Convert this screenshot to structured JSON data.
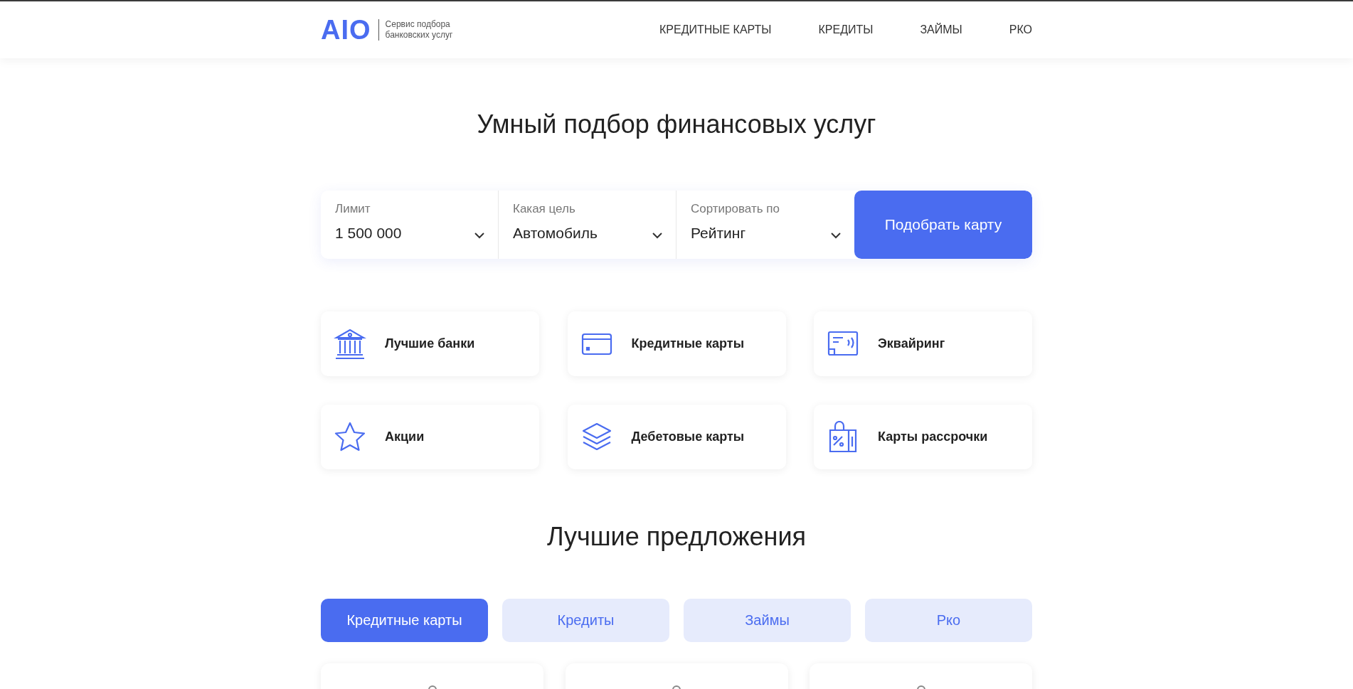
{
  "header": {
    "logo": "AIO",
    "tagline": "Сервис подбора банковских услуг",
    "nav": [
      "КРЕДИТНЫЕ КАРТЫ",
      "КРЕДИТЫ",
      "ЗАЙМЫ",
      "РКО"
    ]
  },
  "title": "Умный подбор финансовых услуг",
  "search": {
    "fields": [
      {
        "label": "Лимит",
        "value": "1 500 000"
      },
      {
        "label": "Какая цель",
        "value": "Автомобиль"
      },
      {
        "label": "Сортировать по",
        "value": "Рейтинг"
      }
    ],
    "button": "Подобрать карту"
  },
  "categories": [
    {
      "kind": "bank",
      "label": "Лучшие банки"
    },
    {
      "kind": "card",
      "label": "Кредитные карты"
    },
    {
      "kind": "terminal",
      "label": "Эквайринг"
    },
    {
      "kind": "star",
      "label": "Акции"
    },
    {
      "kind": "layers",
      "label": "Дебетовые карты"
    },
    {
      "kind": "bag",
      "label": "Карты рассрочки"
    }
  ],
  "offers": {
    "title": "Лучшие предложения",
    "tabs": [
      {
        "label": "Кредитные карты",
        "selected": true
      },
      {
        "label": "Кредиты",
        "selected": false
      },
      {
        "label": "Займы",
        "selected": false
      },
      {
        "label": "Рко",
        "selected": false
      }
    ],
    "cards": [
      {
        "kind": "loading"
      },
      {
        "kind": "loading"
      },
      {
        "kind": "loading"
      }
    ]
  }
}
